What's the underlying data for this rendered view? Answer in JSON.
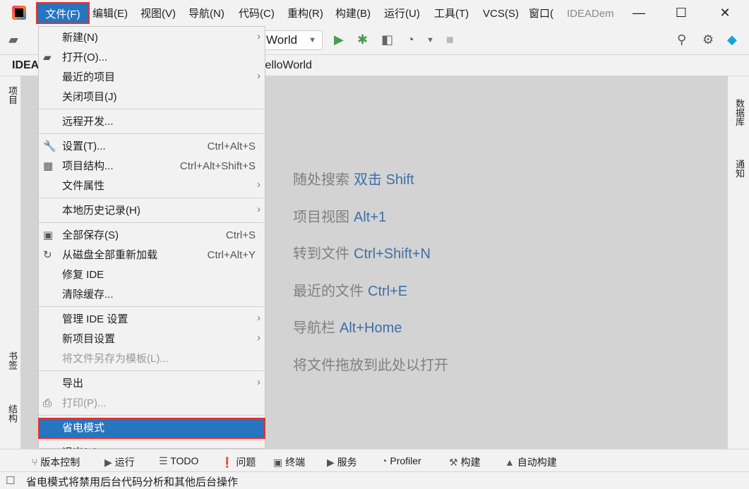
{
  "menubar": {
    "items": [
      "文件(F)",
      "编辑(E)",
      "视图(V)",
      "导航(N)",
      "代码(C)",
      "重构(R)",
      "构建(B)",
      "运行(U)",
      "工具(T)",
      "VCS(S)",
      "窗口(",
      "IDEADem"
    ]
  },
  "window": {
    "minimize": "—",
    "maximize": "☐",
    "close": "✕"
  },
  "toolbar": {
    "run_config": "World"
  },
  "breadcrumb": {
    "project": "IDEA",
    "file": "lelloWorld"
  },
  "left_tools": {
    "project": "项目",
    "bookmarks": "书签",
    "structure": "结构"
  },
  "right_tools": {
    "database": "数据库",
    "notifications": "通知"
  },
  "editor_hints": [
    {
      "text": "随处搜索",
      "key": "双击 Shift"
    },
    {
      "text": "项目视图",
      "key": "Alt+1"
    },
    {
      "text": "转到文件",
      "key": "Ctrl+Shift+N"
    },
    {
      "text": "最近的文件",
      "key": "Ctrl+E"
    },
    {
      "text": "导航栏",
      "key": "Alt+Home"
    },
    {
      "text": "将文件拖放到此处以打开",
      "key": ""
    }
  ],
  "file_menu": [
    {
      "label": "新建(N)",
      "submenu": true
    },
    {
      "label": "打开(O)...",
      "icon": "folder-open-icon"
    },
    {
      "label": "最近的项目",
      "submenu": true
    },
    {
      "label": "关闭项目(J)"
    },
    {
      "sep": true
    },
    {
      "label": "远程开发..."
    },
    {
      "sep": true
    },
    {
      "label": "设置(T)...",
      "shortcut": "Ctrl+Alt+S",
      "icon": "wrench-icon"
    },
    {
      "label": "项目结构...",
      "shortcut": "Ctrl+Alt+Shift+S",
      "icon": "project-structure-icon"
    },
    {
      "label": "文件属性",
      "submenu": true
    },
    {
      "sep": true
    },
    {
      "label": "本地历史记录(H)",
      "submenu": true
    },
    {
      "sep": true
    },
    {
      "label": "全部保存(S)",
      "shortcut": "Ctrl+S",
      "icon": "save-icon"
    },
    {
      "label": "从磁盘全部重新加载",
      "shortcut": "Ctrl+Alt+Y",
      "icon": "reload-icon"
    },
    {
      "label": "修复 IDE"
    },
    {
      "label": "清除缓存..."
    },
    {
      "sep": true
    },
    {
      "label": "管理 IDE 设置",
      "submenu": true
    },
    {
      "label": "新项目设置",
      "submenu": true
    },
    {
      "label": "将文件另存为模板(L)...",
      "disabled": true
    },
    {
      "sep": true
    },
    {
      "label": "导出",
      "submenu": true
    },
    {
      "label": "打印(P)...",
      "disabled": true,
      "icon": "print-icon"
    },
    {
      "sep": true
    },
    {
      "label": "省电模式",
      "selected": true
    },
    {
      "sep": true
    },
    {
      "label": "退出(X)"
    }
  ],
  "tool_windows": [
    "版本控制",
    "运行",
    "TODO",
    "问题",
    "终端",
    "服务",
    "Profiler",
    "构建",
    "自动构建"
  ],
  "status": {
    "message": "省电模式将禁用后台代码分析和其他后台操作"
  },
  "colors": {
    "accent": "#2675bf",
    "highlight_border": "#e8302f",
    "run": "#499c54"
  }
}
